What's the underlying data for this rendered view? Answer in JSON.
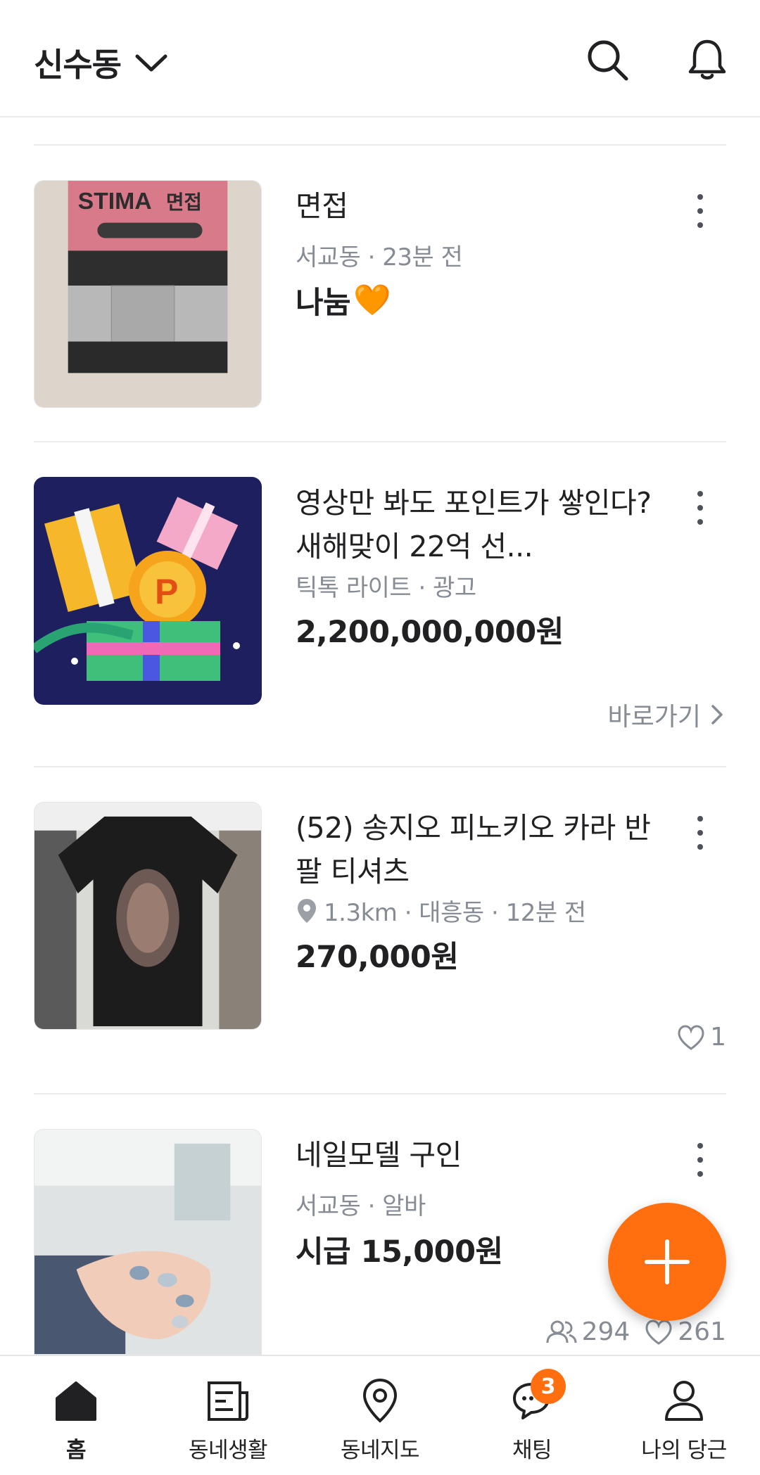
{
  "header": {
    "location": "신수동",
    "icons": [
      "chevron-down-icon",
      "search-icon",
      "bell-icon"
    ]
  },
  "items": [
    {
      "title": "면접",
      "meta": "서교동 · 23분 전",
      "price": "나눔",
      "price_emoji": "🧡",
      "image": "STIMA interview book photo"
    },
    {
      "title": "영상만 봐도 포인트가 쌓인다? 새해맞이 22억 선...",
      "meta": "틱톡 라이트 · 광고",
      "price": "2,200,000,000원",
      "shortcut": "바로가기",
      "image": "gift boxes with coin illustration"
    },
    {
      "title": "(52) 송지오 피노키오 카라 반팔 티셔츠",
      "meta": "1.3km · 대흥동 · 12분 전",
      "price": "270,000원",
      "likes": "1",
      "image": "black short sleeve shirt"
    },
    {
      "title": "네일모델 구인",
      "meta": "서교동 · 알바",
      "price": "시급 15,000원",
      "applicants": "294",
      "likes": "261",
      "image": "nail art hand photo"
    }
  ],
  "nav": [
    {
      "label": "홈",
      "icon": "home-icon",
      "active": true
    },
    {
      "label": "동네생활",
      "icon": "neighborhood-life-icon"
    },
    {
      "label": "동네지도",
      "icon": "map-pin-icon"
    },
    {
      "label": "채팅",
      "icon": "chat-icon",
      "badge": "3"
    },
    {
      "label": "나의 당근",
      "icon": "user-icon"
    }
  ],
  "colors": {
    "brand": "#ff6f0f",
    "text": "#212124",
    "subtext": "#868b94",
    "divider": "#ececec"
  }
}
